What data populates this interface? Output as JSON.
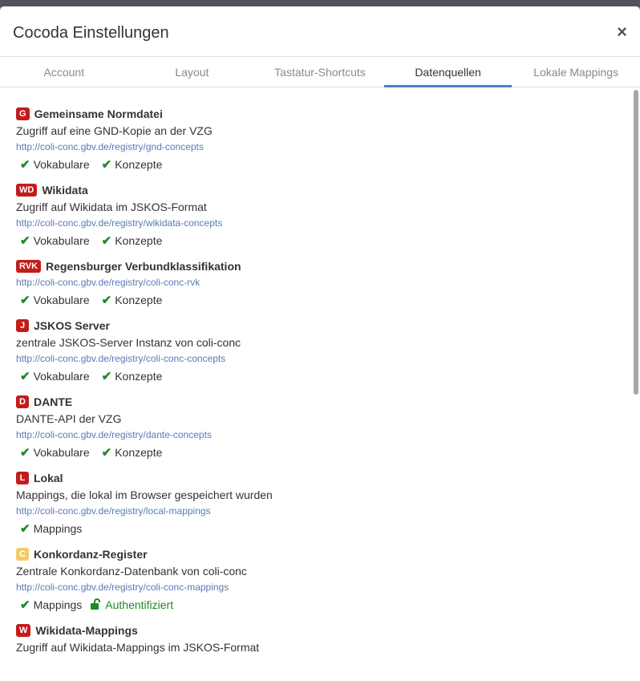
{
  "modal": {
    "title": "Cocoda Einstellungen",
    "close": "×"
  },
  "tabs": [
    {
      "label": "Account"
    },
    {
      "label": "Layout"
    },
    {
      "label": "Tastatur-Shortcuts"
    },
    {
      "label": "Datenquellen"
    },
    {
      "label": "Lokale Mappings"
    }
  ],
  "active_tab": "Datenquellen",
  "colors": {
    "accent": "#4a7fc0",
    "badge_red": "#c41b1b",
    "badge_yellow": "#f5c96a",
    "check_green": "#1d8a27",
    "link": "#5a7ab8"
  },
  "providers": [
    {
      "badge": "G",
      "name": "Gemeinsame Normdatei",
      "desc": "Zugriff auf eine GND-Kopie an der VZG",
      "url": "http://coli-conc.gbv.de/registry/gnd-concepts",
      "caps": [
        "Vokabulare",
        "Konzepte"
      ]
    },
    {
      "badge": "WD",
      "name": "Wikidata",
      "desc": "Zugriff auf Wikidata im JSKOS-Format",
      "url": "http://coli-conc.gbv.de/registry/wikidata-concepts",
      "caps": [
        "Vokabulare",
        "Konzepte"
      ]
    },
    {
      "badge": "RVK",
      "name": "Regensburger Verbundklassifikation",
      "desc": "",
      "url": "http://coli-conc.gbv.de/registry/coli-conc-rvk",
      "caps": [
        "Vokabulare",
        "Konzepte"
      ]
    },
    {
      "badge": "J",
      "name": "JSKOS Server",
      "desc": "zentrale JSKOS-Server Instanz von coli-conc",
      "url": "http://coli-conc.gbv.de/registry/coli-conc-concepts",
      "caps": [
        "Vokabulare",
        "Konzepte"
      ]
    },
    {
      "badge": "D",
      "name": "DANTE",
      "desc": "DANTE-API der VZG",
      "url": "http://coli-conc.gbv.de/registry/dante-concepts",
      "caps": [
        "Vokabulare",
        "Konzepte"
      ]
    },
    {
      "badge": "L",
      "name": "Lokal",
      "desc": "Mappings, die lokal im Browser gespeichert wurden",
      "url": "http://coli-conc.gbv.de/registry/local-mappings",
      "caps": [
        "Mappings"
      ]
    },
    {
      "badge": "C",
      "name": "Konkordanz-Register",
      "desc": "Zentrale Konkordanz-Datenbank von coli-conc",
      "url": "http://coli-conc.gbv.de/registry/coli-conc-mappings",
      "caps": [
        "Mappings"
      ],
      "auth": "Authentifiziert"
    },
    {
      "badge": "W",
      "name": "Wikidata-Mappings",
      "desc": "Zugriff auf Wikidata-Mappings im JSKOS-Format",
      "url": "",
      "caps": []
    }
  ]
}
